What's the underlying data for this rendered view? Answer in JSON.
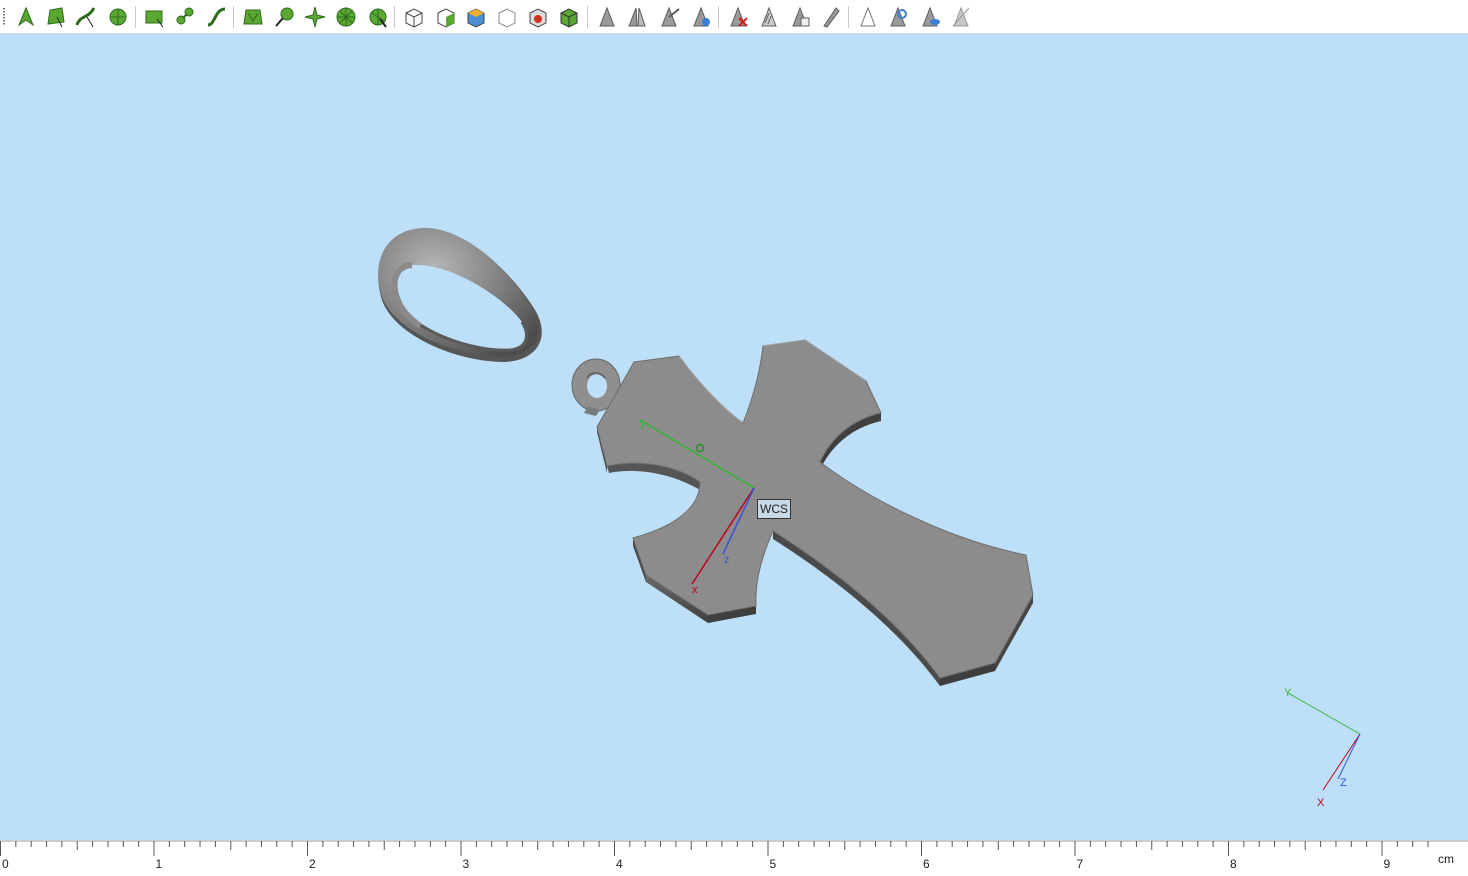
{
  "toolbar": {
    "buttons": [
      {
        "name": "select-arrow-button",
        "icon": "select-arrow-icon"
      },
      {
        "name": "select-face-button",
        "icon": "select-face-icon"
      },
      {
        "name": "select-edge-button",
        "icon": "select-edge-icon"
      },
      {
        "name": "select-circle-button",
        "icon": "select-circle-icon"
      },
      {
        "name": "rectangle-button",
        "icon": "rectangle-icon"
      },
      {
        "name": "node-link-button",
        "icon": "node-link-icon"
      },
      {
        "name": "curve-button",
        "icon": "curve-icon"
      },
      {
        "name": "mesh-select-button",
        "icon": "mesh-select-icon"
      },
      {
        "name": "group-select-button",
        "icon": "group-select-icon"
      },
      {
        "name": "star-select-button",
        "icon": "star-select-icon"
      },
      {
        "name": "radial-select-button",
        "icon": "radial-select-icon"
      },
      {
        "name": "radial-arrow-button",
        "icon": "radial-arrow-icon"
      },
      {
        "name": "box-select-button",
        "icon": "box-select-icon"
      },
      {
        "name": "box-green-button",
        "icon": "box-green-icon"
      },
      {
        "name": "box-colored-button",
        "icon": "box-colored-icon"
      },
      {
        "name": "box-outline-button",
        "icon": "box-outline-icon"
      },
      {
        "name": "box-red-button",
        "icon": "box-red-icon"
      },
      {
        "name": "box-dark-button",
        "icon": "box-dark-icon"
      },
      {
        "name": "cone-button",
        "icon": "cone-icon"
      },
      {
        "name": "cone-split-button",
        "icon": "cone-split-icon"
      },
      {
        "name": "cone-arrow-button",
        "icon": "cone-arrow-icon"
      },
      {
        "name": "cone-blue-button",
        "icon": "cone-blue-icon"
      },
      {
        "name": "cone-delete-button",
        "icon": "cone-delete-icon"
      },
      {
        "name": "cone-hatched-button",
        "icon": "cone-hatched-icon"
      },
      {
        "name": "cone-copy-button",
        "icon": "cone-copy-icon"
      },
      {
        "name": "cone-plane-button",
        "icon": "cone-plane-icon"
      },
      {
        "name": "cone-outline-button",
        "icon": "cone-outline-icon"
      },
      {
        "name": "cone-settings-button",
        "icon": "cone-settings-icon"
      },
      {
        "name": "cone-view-button",
        "icon": "cone-view-icon"
      },
      {
        "name": "cone-disabled-button",
        "icon": "cone-disabled-icon"
      }
    ]
  },
  "viewport": {
    "background_color": "#bde0f8",
    "wcs_label": "WCS",
    "wcs_axes": {
      "x_label": "x",
      "y_label": "y",
      "z_label": "z"
    },
    "corner_triad": {
      "x_label": "X",
      "y_label": "Y",
      "z_label": "Z"
    },
    "colors": {
      "x_axis": "#c0001c",
      "y_axis": "#33b533",
      "z_axis": "#3a52d6"
    }
  },
  "ruler": {
    "labels": [
      "0",
      "1",
      "2",
      "3",
      "4",
      "5",
      "6",
      "7",
      "8",
      "9"
    ],
    "unit": "cm"
  }
}
